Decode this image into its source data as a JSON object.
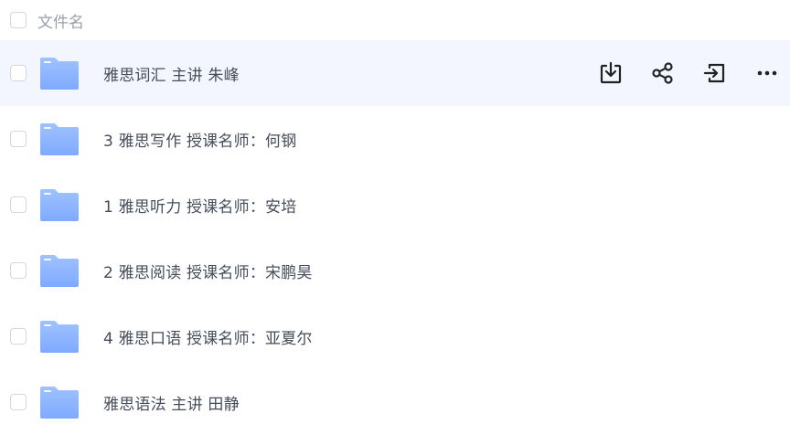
{
  "header": {
    "column_label": "文件名"
  },
  "files": [
    {
      "name": "雅思词汇 主讲 朱峰",
      "type": "folder",
      "hovered": true
    },
    {
      "name": "3 雅思写作 授课名师：何钢",
      "type": "folder",
      "hovered": false
    },
    {
      "name": "1 雅思听力 授课名师：安培",
      "type": "folder",
      "hovered": false
    },
    {
      "name": "2 雅思阅读 授课名师：宋鹏昊",
      "type": "folder",
      "hovered": false
    },
    {
      "name": "4 雅思口语 授课名师：亚夏尔",
      "type": "folder",
      "hovered": false
    },
    {
      "name": "雅思语法 主讲 田静",
      "type": "folder",
      "hovered": false
    }
  ],
  "row_actions": [
    {
      "name": "download",
      "icon": "download-icon"
    },
    {
      "name": "share",
      "icon": "share-icon"
    },
    {
      "name": "move",
      "icon": "move-to-icon"
    },
    {
      "name": "more",
      "icon": "more-icon"
    }
  ],
  "colors": {
    "hover_row": "#f3f6fe",
    "folder_blue": "#8db4ff",
    "text": "#454d5a",
    "muted_text": "#9aa0aa"
  }
}
